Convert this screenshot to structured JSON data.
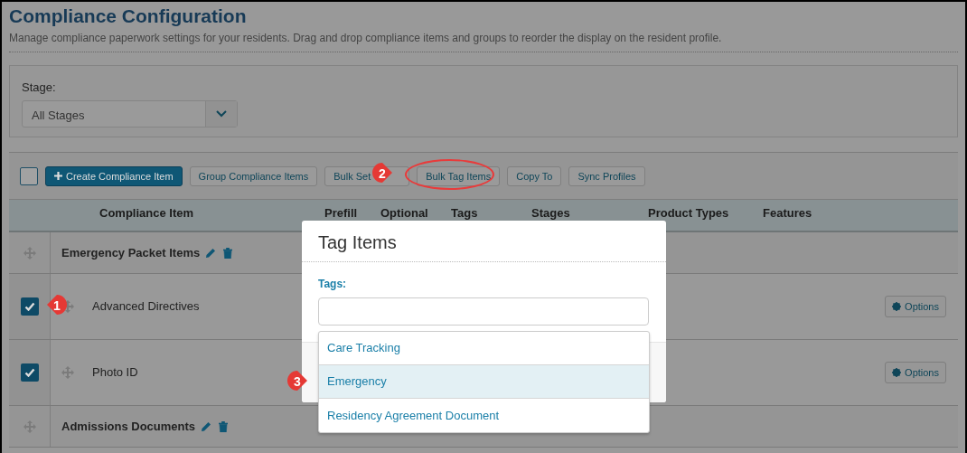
{
  "page": {
    "title": "Compliance Configuration",
    "subtitle": "Manage compliance paperwork settings for your residents. Drag and drop compliance items and groups to reorder the display on the resident profile."
  },
  "stage_filter": {
    "label": "Stage:",
    "value": "All Stages"
  },
  "toolbar": {
    "select_all_checked": false,
    "buttons": [
      {
        "label": "Create Compliance Item",
        "kind": "primary"
      },
      {
        "label": "Group Compliance Items",
        "kind": "default"
      },
      {
        "label": "Bulk Set",
        "kind": "default"
      },
      {
        "label": "Bulk Tag Items",
        "kind": "highlighted"
      },
      {
        "label": "Copy To",
        "kind": "default"
      },
      {
        "label": "Sync Profiles",
        "kind": "default"
      }
    ]
  },
  "table": {
    "columns": [
      "Compliance Item",
      "Prefill",
      "Optional",
      "Tags",
      "Stages",
      "Product Types",
      "Features"
    ],
    "rows": [
      {
        "kind": "group",
        "name": "Emergency Packet Items"
      },
      {
        "kind": "item",
        "name": "Advanced Directives",
        "checked": true,
        "action": "Options"
      },
      {
        "kind": "item",
        "name": "Photo ID",
        "checked": true,
        "action": "Options"
      },
      {
        "kind": "group",
        "name": "Admissions Documents"
      }
    ]
  },
  "modal": {
    "title": "Tag Items",
    "field_label": "Tags:",
    "options": [
      {
        "label": "Care Tracking",
        "selected": false
      },
      {
        "label": "Emergency",
        "selected": true
      },
      {
        "label": "Residency Agreement Document",
        "selected": false
      }
    ]
  },
  "callouts": [
    {
      "number": "1"
    },
    {
      "number": "2"
    },
    {
      "number": "3"
    }
  ]
}
